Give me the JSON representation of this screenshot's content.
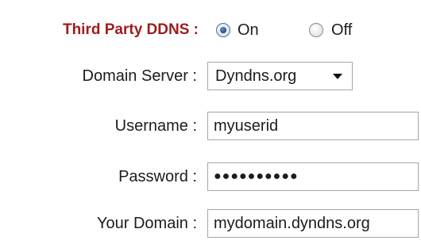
{
  "ddns": {
    "label": "Third Party DDNS :",
    "on_label": "On",
    "off_label": "Off",
    "selected": "On"
  },
  "domain_server": {
    "label": "Domain Server :",
    "value": "Dyndns.org"
  },
  "username": {
    "label": "Username :",
    "value": "myuserid"
  },
  "password": {
    "label": "Password :",
    "value": "●●●●●●●●●●"
  },
  "your_domain": {
    "label": "Your Domain :",
    "value": "mydomain.dyndns.org"
  },
  "colors": {
    "heading": "#9e1b1b",
    "text": "#1c1c1c",
    "field_border": "#a6a6a6",
    "radio_selected": "#1d3f74"
  }
}
